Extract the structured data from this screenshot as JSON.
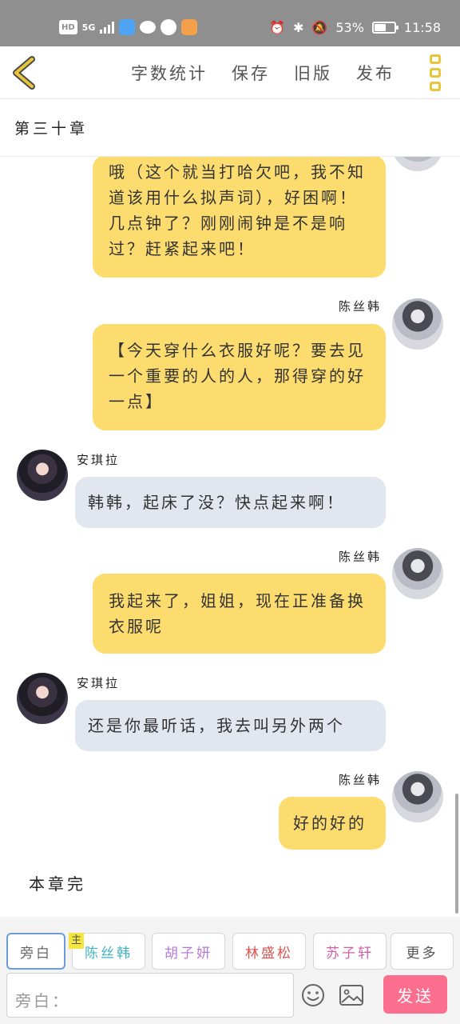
{
  "status_bar": {
    "hd": "HD",
    "network": "5G",
    "battery_text": "53%",
    "battery_level": 0.53,
    "time": "11:58"
  },
  "appbar": {
    "actions": [
      "字数统计",
      "保存",
      "旧版",
      "发布"
    ]
  },
  "chapter": {
    "title": "第三十章"
  },
  "chat": {
    "messages": [
      {
        "speaker": "",
        "side": "right",
        "text": "哦（这个就当打哈欠吧，我不知道该用什么拟声词），好困啊！几点钟了？刚刚闹钟是不是响过？赶紧起来吧！"
      },
      {
        "speaker": "陈丝韩",
        "side": "right",
        "text": "【今天穿什么衣服好呢？要去见一个重要的人的人，那得穿的好一点】"
      },
      {
        "speaker": "安琪拉",
        "side": "left",
        "text": "韩韩，起床了没？快点起来啊！"
      },
      {
        "speaker": "陈丝韩",
        "side": "right",
        "text": "我起来了，姐姐，现在正准备换衣服呢"
      },
      {
        "speaker": "安琪拉",
        "side": "left",
        "text": "还是你最听话，我去叫另外两个"
      },
      {
        "speaker": "陈丝韩",
        "side": "right",
        "text": "好的好的"
      }
    ],
    "end_text": "本章完"
  },
  "composer": {
    "main_tag": "主",
    "roles": [
      {
        "label": "旁白",
        "color": "#666666"
      },
      {
        "label": "陈丝韩",
        "color": "#3fb3c4"
      },
      {
        "label": "胡子妍",
        "color": "#b77ad6"
      },
      {
        "label": "林盛松",
        "color": "#d9534f"
      },
      {
        "label": "苏子轩",
        "color": "#d45fa8"
      },
      {
        "label": "更多",
        "color": "#555555"
      }
    ],
    "input_text": "旁白：",
    "send_label": "发送"
  }
}
